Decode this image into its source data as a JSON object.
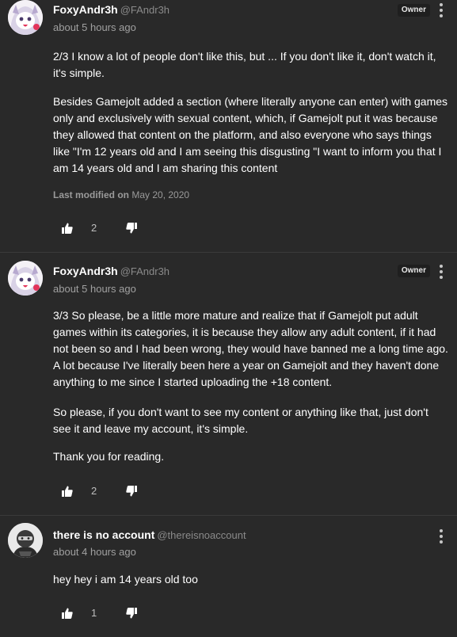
{
  "comments": [
    {
      "display_name": "FoxyAndr3h",
      "username": "@FAndr3h",
      "timestamp": "about 5 hours ago",
      "badge": "Owner",
      "paragraphs": [
        "2/3 I know a lot of people don't like this, but ... If you don't like it, don't watch it, it's simple.",
        "Besides Gamejolt added a section (where literally anyone can enter) with games only and exclusively with sexual content, which, if Gamejolt put it was because they allowed that content on the platform, and also everyone who says things like \"I'm 12 years old and I am seeing this disgusting \"I want to inform you that I am 14 years old and I am sharing this content"
      ],
      "modified_label": "Last modified on",
      "modified_date": "May 20, 2020",
      "like_count": "2"
    },
    {
      "display_name": "FoxyAndr3h",
      "username": "@FAndr3h",
      "timestamp": "about 5 hours ago",
      "badge": "Owner",
      "paragraphs": [
        "3/3 So please, be a little more mature and realize that if Gamejolt put adult games within its categories, it is because they allow any adult content, if it had not been so and I had been wrong, they would have banned me a long time ago. A lot because I've literally been here a year on Gamejolt and they haven't done anything to me since I started uploading the +18 content.",
        "So please, if you don't want to see my content or anything like that, just don't see it and leave my account, it's simple.",
        "Thank you for reading."
      ],
      "like_count": "2"
    },
    {
      "display_name": "there is no account",
      "username": "@thereisnoaccount",
      "timestamp": "about 4 hours ago",
      "paragraphs": [
        "hey hey i am 14 years old too"
      ],
      "like_count": "1"
    }
  ],
  "icons": {
    "like": "thumbs-up-icon",
    "dislike": "thumbs-down-icon",
    "menu": "more-vertical-icon"
  },
  "colors": {
    "background": "#292929",
    "text": "#ffffff",
    "muted": "#a0a0a0",
    "badge_bg": "#1f1f1f"
  }
}
